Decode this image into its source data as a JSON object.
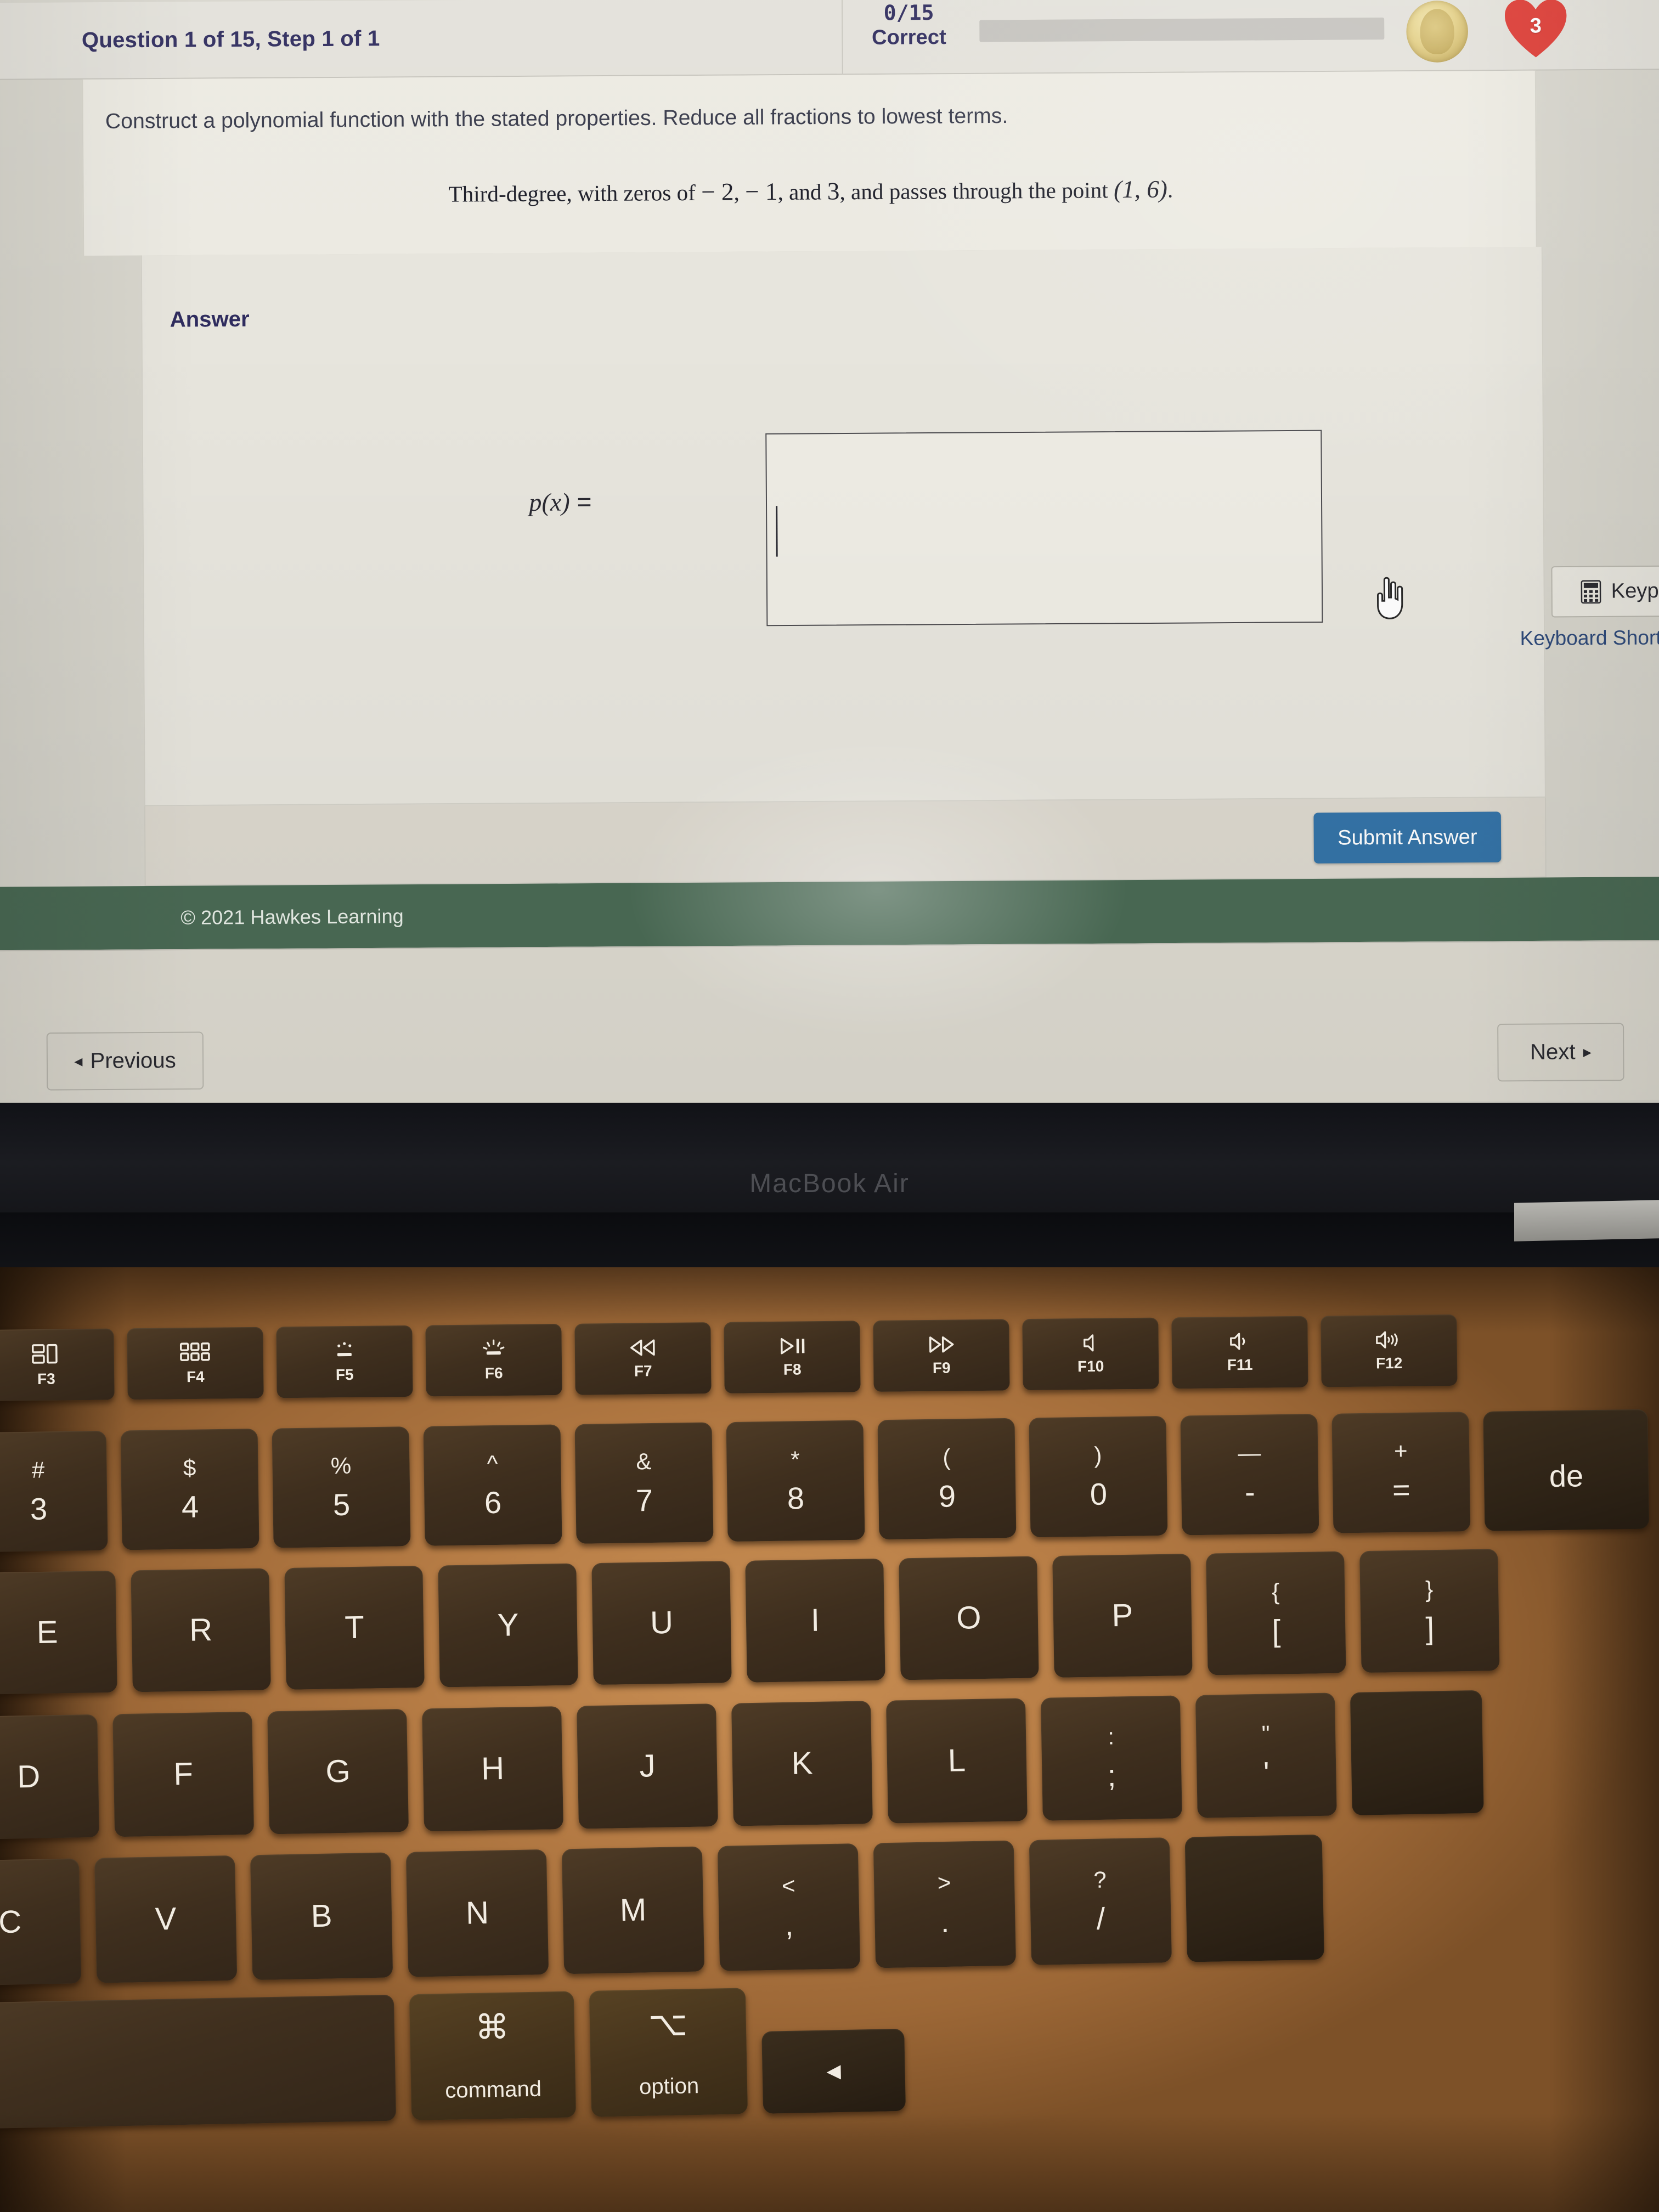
{
  "header": {
    "question_title": "Question 1 of 15, Step 1 of 1",
    "score_value": "0/15",
    "score_label": "Correct",
    "progress_percent": 0,
    "coin_icon": "gold-coin-icon",
    "heart_icon": "red-heart-icon",
    "lives_count": "3"
  },
  "question": {
    "prompt": "Construct a polynomial function with the stated properties. Reduce all fractions to lowest terms.",
    "statement_prefix": "Third-degree, with zeros of ",
    "zero_1": "− 2",
    "sep_1": ", ",
    "zero_2": "− 1",
    "sep_2": ", and ",
    "zero_3": "3",
    "statement_middle": ", and passes through the point ",
    "point": "(1, 6)",
    "statement_end": "."
  },
  "answer": {
    "section_label": "Answer",
    "keypad_label": "Keypad",
    "keypad_icon": "calculator-icon",
    "keyboard_shortcuts_label": "Keyboard Shortcuts",
    "cursor_icon": "hand-pointer-cursor",
    "equation_function": "p",
    "equation_arg": "x",
    "equation_equals": "=",
    "input_value": "",
    "input_placeholder": ""
  },
  "submit": {
    "submit_label": "Submit Answer",
    "submit_color": "#3574a8"
  },
  "footer": {
    "copyright": "© 2021 Hawkes Learning",
    "bar_color": "#4b6b55"
  },
  "nav": {
    "previous_arrow": "◂",
    "previous_label": "Previous",
    "next_label": "Next",
    "next_arrow": "▸"
  },
  "device": {
    "brand_label": "MacBook Air"
  },
  "keyboard": {
    "function_row": [
      {
        "name": "f3-mission-control",
        "icon": "mission-control-icon",
        "label": "F3"
      },
      {
        "name": "f4-launchpad",
        "icon": "launchpad-grid-icon",
        "label": "F4"
      },
      {
        "name": "f5-keyboard-brightness-down",
        "icon": "keyboard-backlight-down-icon",
        "label": "F5"
      },
      {
        "name": "f6-keyboard-brightness-up",
        "icon": "keyboard-backlight-up-icon",
        "label": "F6"
      },
      {
        "name": "f7-rewind",
        "icon": "rewind-icon",
        "label": "F7"
      },
      {
        "name": "f8-play-pause",
        "icon": "play-pause-icon",
        "label": "F8"
      },
      {
        "name": "f9-fast-forward",
        "icon": "fast-forward-icon",
        "label": "F9"
      },
      {
        "name": "f10-mute",
        "icon": "speaker-mute-icon",
        "label": "F10"
      },
      {
        "name": "f11-volume-down",
        "icon": "speaker-low-icon",
        "label": "F11"
      },
      {
        "name": "f12-volume-up",
        "icon": "speaker-high-icon",
        "label": "F12"
      }
    ],
    "number_row": [
      {
        "name": "key-3",
        "top": "#",
        "bottom": "3"
      },
      {
        "name": "key-4",
        "top": "$",
        "bottom": "4"
      },
      {
        "name": "key-5",
        "top": "%",
        "bottom": "5"
      },
      {
        "name": "key-6",
        "top": "^",
        "bottom": "6"
      },
      {
        "name": "key-7",
        "top": "&",
        "bottom": "7"
      },
      {
        "name": "key-8",
        "top": "*",
        "bottom": "8"
      },
      {
        "name": "key-9",
        "top": "(",
        "bottom": "9"
      },
      {
        "name": "key-0",
        "top": ")",
        "bottom": "0"
      },
      {
        "name": "key-minus",
        "top": "—",
        "bottom": "-"
      },
      {
        "name": "key-equals",
        "top": "+",
        "bottom": "="
      },
      {
        "name": "key-delete",
        "top": "",
        "bottom": "de"
      }
    ],
    "qwerty_row": [
      {
        "name": "key-e",
        "letter": "E"
      },
      {
        "name": "key-r",
        "letter": "R"
      },
      {
        "name": "key-t",
        "letter": "T"
      },
      {
        "name": "key-y",
        "letter": "Y"
      },
      {
        "name": "key-u",
        "letter": "U"
      },
      {
        "name": "key-i",
        "letter": "I"
      },
      {
        "name": "key-o",
        "letter": "O"
      },
      {
        "name": "key-p",
        "letter": "P"
      },
      {
        "name": "key-left-bracket",
        "top": "{",
        "bottom": "["
      },
      {
        "name": "key-right-bracket",
        "top": "}",
        "bottom": "]"
      }
    ],
    "home_row": [
      {
        "name": "key-d",
        "letter": "D"
      },
      {
        "name": "key-f",
        "letter": "F"
      },
      {
        "name": "key-g",
        "letter": "G"
      },
      {
        "name": "key-h",
        "letter": "H"
      },
      {
        "name": "key-j",
        "letter": "J"
      },
      {
        "name": "key-k",
        "letter": "K"
      },
      {
        "name": "key-l",
        "letter": "L"
      },
      {
        "name": "key-semicolon",
        "top": ":",
        "bottom": ";"
      },
      {
        "name": "key-quote",
        "top": "\"",
        "bottom": "'"
      }
    ],
    "bottom_row": [
      {
        "name": "key-c",
        "letter": "C"
      },
      {
        "name": "key-v",
        "letter": "V"
      },
      {
        "name": "key-b",
        "letter": "B"
      },
      {
        "name": "key-n",
        "letter": "N"
      },
      {
        "name": "key-m",
        "letter": "M"
      },
      {
        "name": "key-comma",
        "top": "<",
        "bottom": ","
      },
      {
        "name": "key-period",
        "top": ">",
        "bottom": "."
      },
      {
        "name": "key-slash",
        "top": "?",
        "bottom": "/"
      }
    ],
    "space_row": [
      {
        "name": "key-space",
        "label": ""
      },
      {
        "name": "key-command",
        "glyph": "⌘",
        "label": "command"
      },
      {
        "name": "key-option",
        "glyph": "⌥",
        "label": "option"
      },
      {
        "name": "key-arrow-left",
        "glyph": "◀",
        "label": ""
      }
    ]
  }
}
